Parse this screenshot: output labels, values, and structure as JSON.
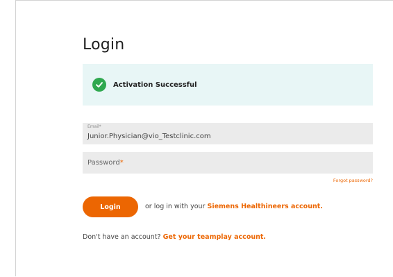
{
  "page": {
    "title": "Login"
  },
  "alert": {
    "icon": "check-circle-icon",
    "message": "Activation Successful",
    "background": "#e8f6f6",
    "icon_color": "#2fa84f"
  },
  "form": {
    "email": {
      "label": "Email*",
      "value": "Junior.Physician@vio_Testclinic.com"
    },
    "password": {
      "label": "Password",
      "required_mark": "*",
      "value": ""
    },
    "forgot_password": "Forgot password?",
    "login_button": "Login",
    "alt_login_prefix": "or log in with your ",
    "alt_login_link": "Siemens Healthineers account.",
    "signup_prefix": "Don't have an account? ",
    "signup_link": "Get your teamplay account."
  },
  "colors": {
    "accent": "#ec6602",
    "field_background": "#ebebeb"
  }
}
